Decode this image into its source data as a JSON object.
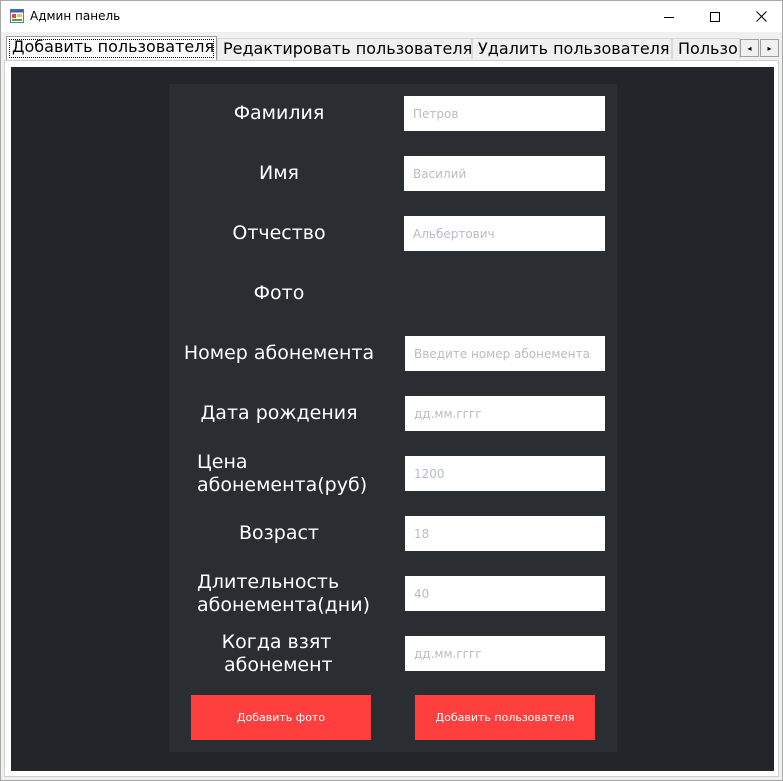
{
  "window": {
    "title": "Админ панель",
    "icon": "app-window-icon",
    "controls": {
      "minimize": "─",
      "maximize": "☐",
      "close": "✕"
    }
  },
  "tabs": [
    {
      "label": "Добавить пользователя",
      "active": true
    },
    {
      "label": "Редактировать пользователя",
      "active": false
    },
    {
      "label": "Удалить пользователя",
      "active": false
    },
    {
      "label": "Пользо",
      "active": false
    }
  ],
  "tab_scroll": {
    "left": "◂",
    "right": "▸"
  },
  "form": {
    "last_name": {
      "label": "Фамилия",
      "value": "",
      "placeholder": "Петров"
    },
    "first_name": {
      "label": "Имя",
      "value": "",
      "placeholder": "Василий"
    },
    "patronymic": {
      "label": "Отчество",
      "value": "",
      "placeholder": "Альбертович"
    },
    "photo": {
      "label": "Фото"
    },
    "membership_number": {
      "label": "Номер абонемента",
      "value": "",
      "placeholder": "Введите номер абонемента"
    },
    "birth_date": {
      "label": "Дата рождения",
      "value": "",
      "placeholder": "дд.мм.гггг"
    },
    "price": {
      "label_line1": "Цена",
      "label_line2": "абонемента(руб)",
      "value": "",
      "placeholder": "1200"
    },
    "age": {
      "label": "Возраст",
      "value": "",
      "placeholder": "18"
    },
    "duration": {
      "label_line1": "Длительность",
      "label_line2": "абонемента(дни)",
      "value": "",
      "placeholder": "40"
    },
    "taken_date": {
      "label_line1": "Когда взят",
      "label_line2": "абонемент",
      "value": "",
      "placeholder": "дд.мм.гггг"
    }
  },
  "buttons": {
    "add_photo": "Добавить фото",
    "add_user": "Добавить пользователя"
  },
  "colors": {
    "background_dark": "#222529",
    "card": "#2a2d32",
    "accent_button": "#ff3e3e",
    "placeholder": "#b7bcc4"
  }
}
